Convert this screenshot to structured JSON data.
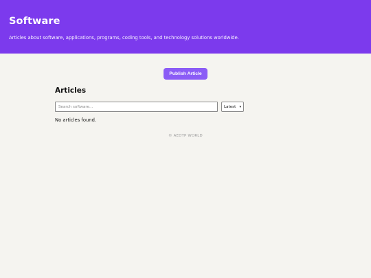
{
  "header": {
    "title": "Software",
    "subtitle": "Articles about software, applications, programs, coding tools, and technology solutions worldwide."
  },
  "actions": {
    "publish_label": "Publish Article"
  },
  "articles": {
    "heading": "Articles",
    "search_placeholder": "Search software...",
    "sort_selected": "Latest",
    "empty_message": "No articles found."
  },
  "footer": {
    "text": "© AEDTP WORLD"
  },
  "colors": {
    "header_bg": "#7c3aed",
    "button_bg": "#8b5cf6",
    "page_bg": "#f5f4f0"
  }
}
